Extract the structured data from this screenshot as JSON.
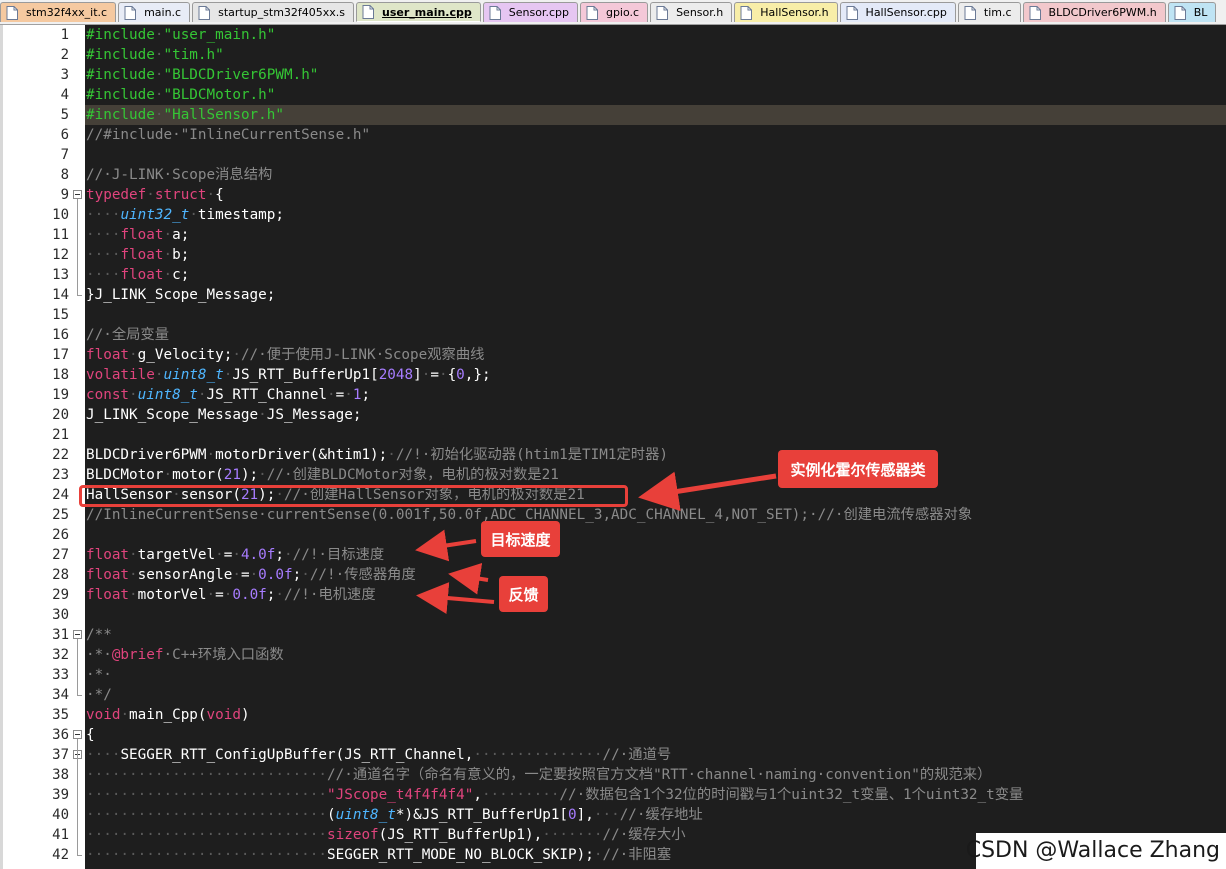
{
  "tabs": [
    {
      "label": "stm32f4xx_it.c",
      "color": "#f5c9a0",
      "active": false
    },
    {
      "label": "main.c",
      "color": "#e8ecf6",
      "active": false
    },
    {
      "label": "startup_stm32f405xx.s",
      "color": "#e6e6e6",
      "active": false
    },
    {
      "label": "user_main.cpp",
      "color": "#dfe6c8",
      "active": true
    },
    {
      "label": "Sensor.cpp",
      "color": "#e6c6f2",
      "active": false
    },
    {
      "label": "gpio.c",
      "color": "#f4c8d8",
      "active": false
    },
    {
      "label": "Sensor.h",
      "color": "#ececec",
      "active": false
    },
    {
      "label": "HallSensor.h",
      "color": "#f8eea8",
      "active": false
    },
    {
      "label": "HallSensor.cpp",
      "color": "#e4eaf8",
      "active": false
    },
    {
      "label": "tim.c",
      "color": "#ececec",
      "active": false
    },
    {
      "label": "BLDCDriver6PWM.h",
      "color": "#f2c8cc",
      "active": false
    },
    {
      "label": "BL",
      "color": "#bfe4f4",
      "active": false
    }
  ],
  "editor": {
    "current_line": 5,
    "lines": [
      {
        "n": "1",
        "fold": "",
        "t": [
          [
            "pp",
            "#include"
          ],
          [
            "ws",
            "·"
          ],
          [
            "pp",
            "\"user_main.h\""
          ]
        ]
      },
      {
        "n": "2",
        "fold": "",
        "t": [
          [
            "pp",
            "#include"
          ],
          [
            "ws",
            "·"
          ],
          [
            "pp",
            "\"tim.h\""
          ]
        ]
      },
      {
        "n": "3",
        "fold": "",
        "t": [
          [
            "pp",
            "#include"
          ],
          [
            "ws",
            "·"
          ],
          [
            "pp",
            "\"BLDCDriver6PWM.h\""
          ]
        ]
      },
      {
        "n": "4",
        "fold": "",
        "t": [
          [
            "pp",
            "#include"
          ],
          [
            "ws",
            "·"
          ],
          [
            "pp",
            "\"BLDCMotor.h\""
          ]
        ]
      },
      {
        "n": "5",
        "fold": "",
        "t": [
          [
            "pp",
            "#include"
          ],
          [
            "ws",
            "·"
          ],
          [
            "pp",
            "\"HallSensor.h\""
          ]
        ]
      },
      {
        "n": "6",
        "fold": "",
        "t": [
          [
            "cm",
            "//#include·\"InlineCurrentSense.h\""
          ]
        ]
      },
      {
        "n": "7",
        "fold": "",
        "t": []
      },
      {
        "n": "8",
        "fold": "",
        "t": [
          [
            "cm",
            "//·J-LINK·Scope消息结构"
          ]
        ]
      },
      {
        "n": "9",
        "fold": "open",
        "t": [
          [
            "kw",
            "typedef"
          ],
          [
            "ws",
            "·"
          ],
          [
            "kw",
            "struct"
          ],
          [
            "ws",
            "·"
          ],
          [
            "id",
            "{"
          ]
        ]
      },
      {
        "n": "10",
        "fold": "",
        "t": [
          [
            "ws",
            "····"
          ],
          [
            "ty",
            "uint32_t"
          ],
          [
            "ws",
            "·"
          ],
          [
            "id",
            "timestamp;"
          ]
        ]
      },
      {
        "n": "11",
        "fold": "",
        "t": [
          [
            "ws",
            "····"
          ],
          [
            "kw",
            "float"
          ],
          [
            "ws",
            "·"
          ],
          [
            "id",
            "a;"
          ]
        ]
      },
      {
        "n": "12",
        "fold": "",
        "t": [
          [
            "ws",
            "····"
          ],
          [
            "kw",
            "float"
          ],
          [
            "ws",
            "·"
          ],
          [
            "id",
            "b;"
          ]
        ]
      },
      {
        "n": "13",
        "fold": "",
        "t": [
          [
            "ws",
            "····"
          ],
          [
            "kw",
            "float"
          ],
          [
            "ws",
            "·"
          ],
          [
            "id",
            "c;"
          ]
        ]
      },
      {
        "n": "14",
        "fold": "end",
        "t": [
          [
            "id",
            "}J_LINK_Scope_Message;"
          ]
        ]
      },
      {
        "n": "15",
        "fold": "",
        "t": []
      },
      {
        "n": "16",
        "fold": "",
        "t": [
          [
            "cm",
            "//·全局变量"
          ]
        ]
      },
      {
        "n": "17",
        "fold": "",
        "t": [
          [
            "kw",
            "float"
          ],
          [
            "ws",
            "·"
          ],
          [
            "id",
            "g_Velocity;"
          ],
          [
            "ws",
            "·"
          ],
          [
            "cm",
            "//·便于使用J-LINK·Scope观察曲线"
          ]
        ]
      },
      {
        "n": "18",
        "fold": "",
        "t": [
          [
            "kw",
            "volatile"
          ],
          [
            "ws",
            "·"
          ],
          [
            "ty",
            "uint8_t"
          ],
          [
            "ws",
            "·"
          ],
          [
            "id",
            "JS_RTT_BufferUp1["
          ],
          [
            "nm",
            "2048"
          ],
          [
            "id",
            "]"
          ],
          [
            "ws",
            "·"
          ],
          [
            "id",
            "="
          ],
          [
            "ws",
            "·"
          ],
          [
            "id",
            "{"
          ],
          [
            "nm",
            "0"
          ],
          [
            "id",
            ",};"
          ]
        ]
      },
      {
        "n": "19",
        "fold": "",
        "t": [
          [
            "kw",
            "const"
          ],
          [
            "ws",
            "·"
          ],
          [
            "ty",
            "uint8_t"
          ],
          [
            "ws",
            "·"
          ],
          [
            "id",
            "JS_RTT_Channel"
          ],
          [
            "ws",
            "·"
          ],
          [
            "id",
            "="
          ],
          [
            "ws",
            "·"
          ],
          [
            "nm",
            "1"
          ],
          [
            "id",
            ";"
          ]
        ]
      },
      {
        "n": "20",
        "fold": "",
        "t": [
          [
            "id",
            "J_LINK_Scope_Message"
          ],
          [
            "ws",
            "·"
          ],
          [
            "id",
            "JS_Message;"
          ]
        ]
      },
      {
        "n": "21",
        "fold": "",
        "t": []
      },
      {
        "n": "22",
        "fold": "",
        "t": [
          [
            "id",
            "BLDCDriver6PWM"
          ],
          [
            "ws",
            "·"
          ],
          [
            "id",
            "motorDriver(&htim1);"
          ],
          [
            "ws",
            "·"
          ],
          [
            "cm",
            "//!·初始化驱动器(htim1是TIM1定时器)"
          ]
        ]
      },
      {
        "n": "23",
        "fold": "",
        "t": [
          [
            "id",
            "BLDCMotor"
          ],
          [
            "ws",
            "·"
          ],
          [
            "id",
            "motor("
          ],
          [
            "nm",
            "21"
          ],
          [
            "id",
            ");"
          ],
          [
            "ws",
            "·"
          ],
          [
            "cm",
            "//·创建BLDCMotor对象，电机的极对数是21"
          ]
        ]
      },
      {
        "n": "24",
        "fold": "",
        "t": [
          [
            "id",
            "HallSensor"
          ],
          [
            "ws",
            "·"
          ],
          [
            "id",
            "sensor("
          ],
          [
            "nm",
            "21"
          ],
          [
            "id",
            ");"
          ],
          [
            "ws",
            "·"
          ],
          [
            "cm",
            "//·创建HallSensor对象，电机的极对数是21"
          ]
        ]
      },
      {
        "n": "25",
        "fold": "",
        "t": [
          [
            "cm",
            "//InlineCurrentSense·currentSense(0.001f,50.0f,ADC_CHANNEL_3,ADC_CHANNEL_4,NOT_SET);·//·创建电流传感器对象"
          ]
        ]
      },
      {
        "n": "26",
        "fold": "",
        "t": []
      },
      {
        "n": "27",
        "fold": "",
        "t": [
          [
            "kw",
            "float"
          ],
          [
            "ws",
            "·"
          ],
          [
            "id",
            "targetVel"
          ],
          [
            "ws",
            "·"
          ],
          [
            "id",
            "="
          ],
          [
            "ws",
            "·"
          ],
          [
            "nm",
            "4.0f"
          ],
          [
            "id",
            ";"
          ],
          [
            "ws",
            "·"
          ],
          [
            "cm",
            "//!·目标速度"
          ]
        ]
      },
      {
        "n": "28",
        "fold": "",
        "t": [
          [
            "kw",
            "float"
          ],
          [
            "ws",
            "·"
          ],
          [
            "id",
            "sensorAngle"
          ],
          [
            "ws",
            "·"
          ],
          [
            "id",
            "="
          ],
          [
            "ws",
            "·"
          ],
          [
            "nm",
            "0.0f"
          ],
          [
            "id",
            ";"
          ],
          [
            "ws",
            "·"
          ],
          [
            "cm",
            "//!·传感器角度"
          ]
        ]
      },
      {
        "n": "29",
        "fold": "",
        "t": [
          [
            "kw",
            "float"
          ],
          [
            "ws",
            "·"
          ],
          [
            "id",
            "motorVel"
          ],
          [
            "ws",
            "·"
          ],
          [
            "id",
            "="
          ],
          [
            "ws",
            "·"
          ],
          [
            "nm",
            "0.0f"
          ],
          [
            "id",
            ";"
          ],
          [
            "ws",
            "·"
          ],
          [
            "cm",
            "//!·电机速度"
          ]
        ]
      },
      {
        "n": "30",
        "fold": "",
        "t": []
      },
      {
        "n": "31",
        "fold": "open",
        "t": [
          [
            "cm",
            "/**"
          ]
        ]
      },
      {
        "n": "32",
        "fold": "",
        "t": [
          [
            "cm",
            "·*·"
          ],
          [
            "kw",
            "@brief"
          ],
          [
            "cm",
            "·C++环境入口函数"
          ]
        ]
      },
      {
        "n": "33",
        "fold": "",
        "t": [
          [
            "cm",
            "·*·"
          ]
        ]
      },
      {
        "n": "34",
        "fold": "end",
        "t": [
          [
            "cm",
            "·*/"
          ]
        ]
      },
      {
        "n": "35",
        "fold": "",
        "t": [
          [
            "kw",
            "void"
          ],
          [
            "ws",
            "·"
          ],
          [
            "id",
            "main_Cpp("
          ],
          [
            "kw",
            "void"
          ],
          [
            "id",
            ")"
          ]
        ]
      },
      {
        "n": "36",
        "fold": "open",
        "t": [
          [
            "id",
            "{"
          ]
        ]
      },
      {
        "n": "37",
        "fold": "open",
        "t": [
          [
            "ws",
            "····"
          ],
          [
            "id",
            "SEGGER_RTT_ConfigUpBuffer(JS_RTT_Channel,"
          ],
          [
            "ws",
            "···············"
          ],
          [
            "cm",
            "//·通道号"
          ]
        ]
      },
      {
        "n": "38",
        "fold": "",
        "t": [
          [
            "ws",
            "····························"
          ],
          [
            "cm",
            "//·通道名字（命名有意义的，一定要按照官方文档\"RTT·channel·naming·convention\"的规范来）"
          ]
        ]
      },
      {
        "n": "39",
        "fold": "",
        "t": [
          [
            "ws",
            "····························"
          ],
          [
            "kw",
            "\"JScope_t4f4f4f4\""
          ],
          [
            "id",
            ","
          ],
          [
            "ws",
            "·········"
          ],
          [
            "cm",
            "//·数据包含1个32位的时间戳与1个uint32_t变量、1个uint32_t变量"
          ]
        ]
      },
      {
        "n": "40",
        "fold": "",
        "t": [
          [
            "ws",
            "····························"
          ],
          [
            "id",
            "("
          ],
          [
            "ty",
            "uint8_t"
          ],
          [
            "id",
            "*)&JS_RTT_BufferUp1["
          ],
          [
            "nm",
            "0"
          ],
          [
            "id",
            "],"
          ],
          [
            "ws",
            "···"
          ],
          [
            "cm",
            "//·缓存地址"
          ]
        ]
      },
      {
        "n": "41",
        "fold": "",
        "t": [
          [
            "ws",
            "····························"
          ],
          [
            "kw",
            "sizeof"
          ],
          [
            "id",
            "(JS_RTT_BufferUp1),"
          ],
          [
            "ws",
            "·······"
          ],
          [
            "cm",
            "//·缓存大小"
          ]
        ]
      },
      {
        "n": "42",
        "fold": "",
        "t": [
          [
            "ws",
            "····························"
          ],
          [
            "id",
            "SEGGER_RTT_MODE_NO_BLOCK_SKIP);"
          ],
          [
            "ws",
            "·"
          ],
          [
            "cm",
            "//·非阻塞"
          ]
        ]
      }
    ]
  },
  "annotations": {
    "callout_1": "实例化霍尔传感器类",
    "callout_2": "目标速度",
    "callout_3": "反馈"
  },
  "watermark": "CSDN @Wallace Zhang"
}
